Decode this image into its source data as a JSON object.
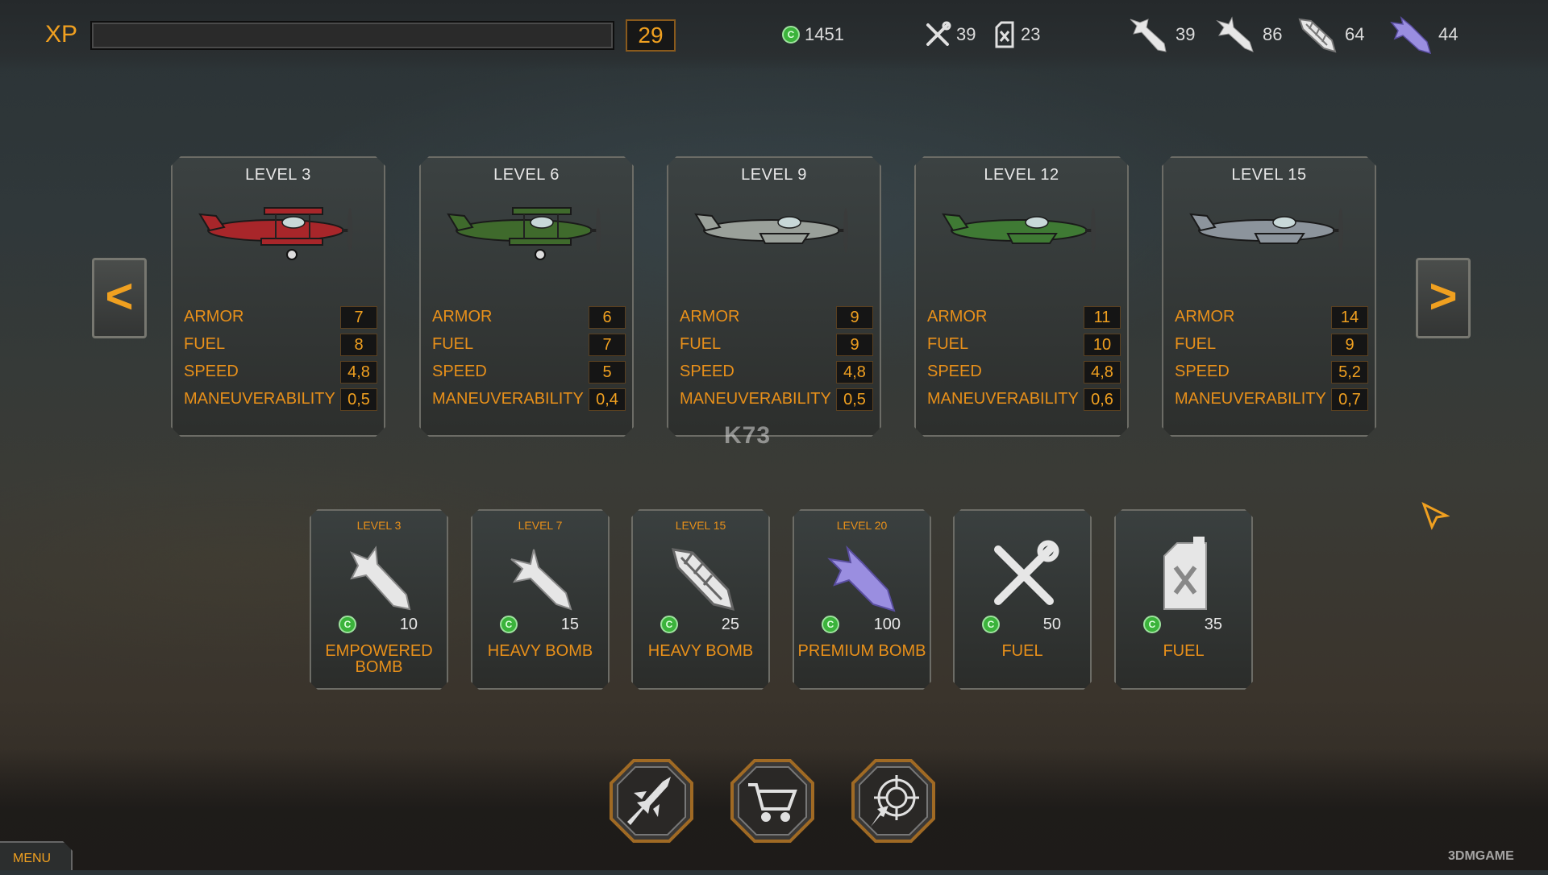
{
  "topbar": {
    "xp_label": "XP",
    "xp_progress": 0,
    "player_level": "29",
    "coins": "1451",
    "repair_kits": "39",
    "fuel_cans": "23",
    "bomb_counts": [
      {
        "icon": "empowered-bomb-icon",
        "count": "39"
      },
      {
        "icon": "heavy-bomb-icon",
        "count": "86"
      },
      {
        "icon": "heavy-bomb-2-icon",
        "count": "64"
      },
      {
        "icon": "premium-bomb-icon",
        "count": "44"
      }
    ]
  },
  "planes": [
    {
      "level": "LEVEL 3",
      "color": "#a8262a",
      "stats": [
        {
          "name": "ARMOR",
          "value": "7"
        },
        {
          "name": "FUEL",
          "value": "8"
        },
        {
          "name": "SPEED",
          "value": "4,8"
        },
        {
          "name": "MANEUVERABILITY",
          "value": "0,5"
        }
      ]
    },
    {
      "level": "LEVEL 6",
      "color": "#3f6a2c",
      "stats": [
        {
          "name": "ARMOR",
          "value": "6"
        },
        {
          "name": "FUEL",
          "value": "7"
        },
        {
          "name": "SPEED",
          "value": "5"
        },
        {
          "name": "MANEUVERABILITY",
          "value": "0,4"
        }
      ]
    },
    {
      "level": "LEVEL 9",
      "color": "#9aa09a",
      "stats": [
        {
          "name": "ARMOR",
          "value": "9"
        },
        {
          "name": "FUEL",
          "value": "9"
        },
        {
          "name": "SPEED",
          "value": "4,8"
        },
        {
          "name": "MANEUVERABILITY",
          "value": "0,5"
        }
      ]
    },
    {
      "level": "LEVEL 12",
      "color": "#3f7a34",
      "stats": [
        {
          "name": "ARMOR",
          "value": "11"
        },
        {
          "name": "FUEL",
          "value": "10"
        },
        {
          "name": "SPEED",
          "value": "4,8"
        },
        {
          "name": "MANEUVERABILITY",
          "value": "0,6"
        }
      ]
    },
    {
      "level": "LEVEL 15",
      "color": "#8c949c",
      "stats": [
        {
          "name": "ARMOR",
          "value": "14"
        },
        {
          "name": "FUEL",
          "value": "9"
        },
        {
          "name": "SPEED",
          "value": "5,2"
        },
        {
          "name": "MANEUVERABILITY",
          "value": "0,7"
        }
      ]
    }
  ],
  "nav": {
    "prev": "<",
    "next": ">"
  },
  "items": [
    {
      "level": "LEVEL 3",
      "price": "10",
      "name": "EMPOWERED BOMB",
      "icon": "empowered-bomb-icon"
    },
    {
      "level": "LEVEL 7",
      "price": "15",
      "name": "HEAVY BOMB",
      "icon": "heavy-bomb-icon"
    },
    {
      "level": "LEVEL 15",
      "price": "25",
      "name": "HEAVY BOMB",
      "icon": "heavy-bomb-2-icon"
    },
    {
      "level": "LEVEL 20",
      "price": "100",
      "name": "PREMIUM BOMB",
      "icon": "premium-bomb-icon"
    },
    {
      "level": "",
      "price": "50",
      "name": "FUEL",
      "icon": "repair-tools-icon"
    },
    {
      "level": "",
      "price": "35",
      "name": "FUEL",
      "icon": "fuel-can-icon"
    }
  ],
  "coin_symbol": "C",
  "bottom_buttons": [
    "hangar-plane-icon",
    "shop-cart-icon",
    "mission-target-icon"
  ],
  "menu_label": "MENU",
  "watermarks": {
    "center": "K73",
    "corner": "3DMGAME"
  }
}
